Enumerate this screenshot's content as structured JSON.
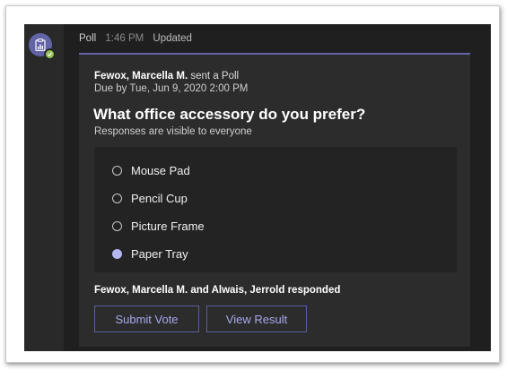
{
  "message": {
    "sender": "Poll",
    "time": "1:46 PM",
    "status": "Updated",
    "avatar_icon": "clipboard-poll-icon",
    "presence_icon": "available-check-icon"
  },
  "card": {
    "author": "Fewox, Marcella M.",
    "action": " sent a Poll",
    "due": "Due by Tue, Jun 9, 2020 2:00 PM",
    "question": "What office accessory do you prefer?",
    "visibility": "Responses are visible to everyone",
    "options": [
      {
        "label": "Mouse Pad",
        "selected": false
      },
      {
        "label": "Pencil Cup",
        "selected": false
      },
      {
        "label": "Picture Frame",
        "selected": false
      },
      {
        "label": "Paper Tray",
        "selected": true
      }
    ],
    "responded": "Fewox, Marcella M. and Alwais, Jerrold responded",
    "submit_label": "Submit Vote",
    "view_label": "View Result"
  },
  "colors": {
    "accent": "#6264a7",
    "accent_text": "#a6a9ef",
    "selected_radio": "#b4b6f0",
    "presence": "#92c353",
    "background": "#1f1f1f",
    "card": "#2d2c2c"
  }
}
